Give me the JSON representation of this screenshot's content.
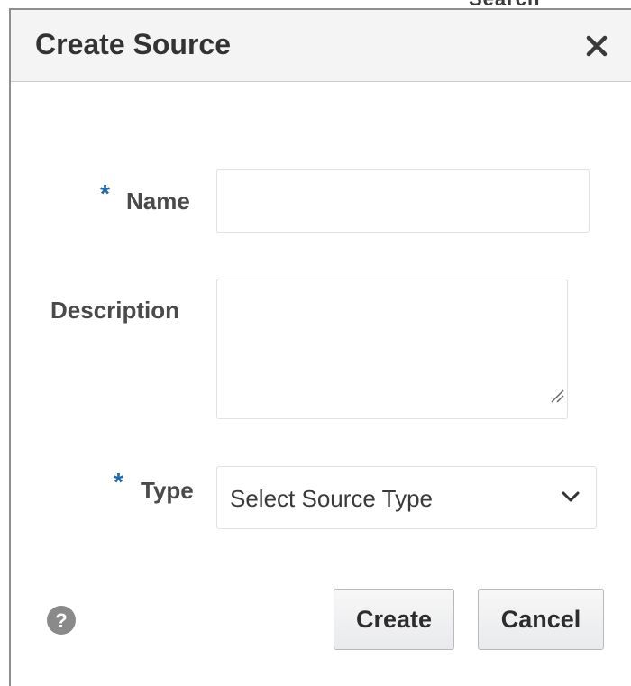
{
  "dialog": {
    "title": "Create Source",
    "close_icon": "close-icon"
  },
  "form": {
    "name": {
      "required_marker": "*",
      "label": "Name",
      "value": "",
      "placeholder": ""
    },
    "description": {
      "label": "Description",
      "value": "",
      "placeholder": ""
    },
    "type": {
      "required_marker": "*",
      "label": "Type",
      "selected": "Select Source Type",
      "dropdown_icon": "chevron-down-icon"
    }
  },
  "footer": {
    "help_icon": "help-icon",
    "create_label": "Create",
    "cancel_label": "Cancel"
  },
  "colors": {
    "required_marker": "#1f6bb0",
    "header_background": "#f4f4f4",
    "text": "#333333"
  }
}
